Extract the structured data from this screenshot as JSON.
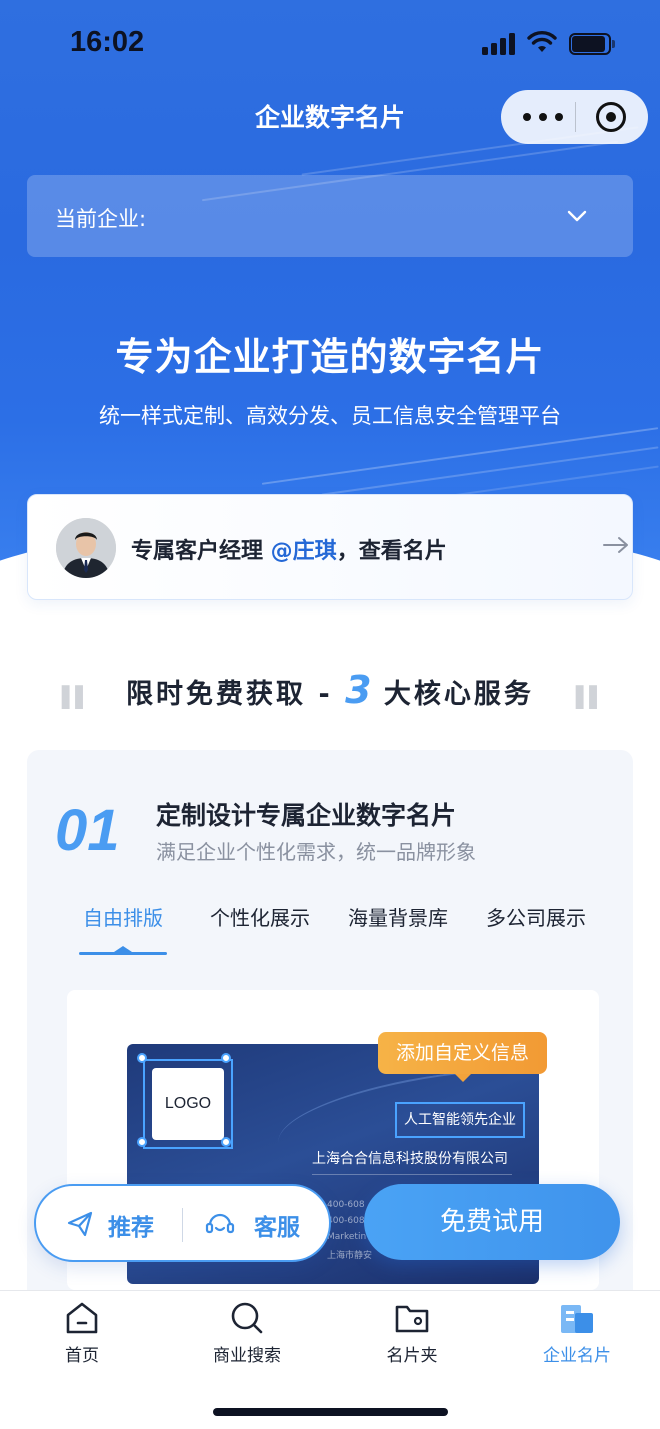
{
  "status_bar": {
    "time": "16:02"
  },
  "nav": {
    "title": "企业数字名片"
  },
  "company_select": {
    "label": "当前企业:"
  },
  "hero": {
    "title": "专为企业打造的数字名片",
    "subtitle": "统一样式定制、高效分发、员工信息安全管理平台"
  },
  "manager": {
    "prefix": "专属客户经理 ",
    "name": "@庄琪",
    "suffix": "，查看名片"
  },
  "section": {
    "title_left": "限时免费获取 - ",
    "number": "3",
    "title_right": " 大核心服务"
  },
  "service": {
    "number": "01",
    "title": "定制设计专属企业数字名片",
    "subtitle": "满足企业个性化需求，统一品牌形象",
    "tabs": [
      {
        "label": "自由排版",
        "active": true
      },
      {
        "label": "个性化展示",
        "active": false
      },
      {
        "label": "海量背景库",
        "active": false
      },
      {
        "label": "多公司展示",
        "active": false
      }
    ],
    "preview": {
      "logo": "LOGO",
      "tag_custom": "添加自定义信息",
      "ai_badge": "人工智能领先企业",
      "company_name": "上海合合信息科技股份有限公司",
      "small_1": "400-608",
      "small_2": "400-608",
      "small_3": "Marketin",
      "small_4": "上海市静安"
    }
  },
  "actions": {
    "recommend": "推荐",
    "service": "客服",
    "try_free": "免费试用"
  },
  "tabbar": {
    "items": [
      {
        "label": "首页",
        "icon": "home-icon",
        "active": false
      },
      {
        "label": "商业搜索",
        "icon": "search-icon",
        "active": false
      },
      {
        "label": "名片夹",
        "icon": "folder-icon",
        "active": false
      },
      {
        "label": "企业名片",
        "icon": "building-icon",
        "active": true
      }
    ]
  },
  "colors": {
    "brand_blue": "#2f6fe0",
    "accent_blue": "#3c8fe8",
    "orange": "#f29a34"
  }
}
